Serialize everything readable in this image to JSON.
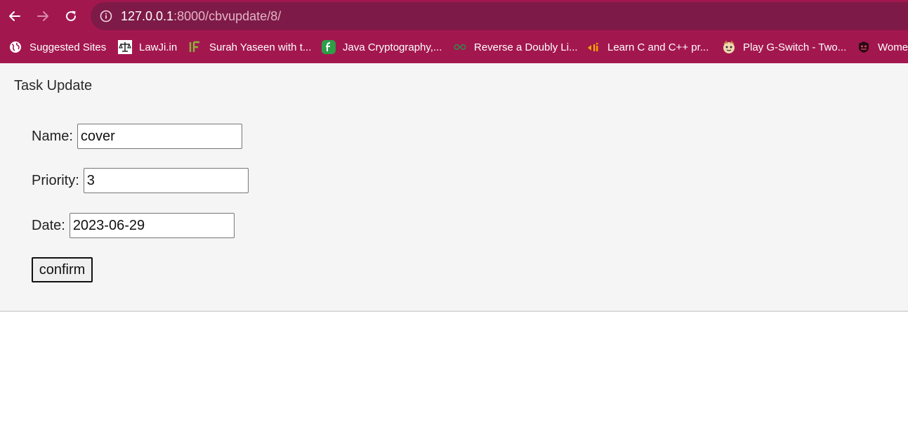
{
  "browser": {
    "url_host": "127.0.0.1",
    "url_path": ":8000/cbvupdate/8/",
    "theme_color": "#a3174f",
    "omnibox_color": "#7e1a47",
    "bookmarks": [
      {
        "label": "Suggested Sites",
        "icon": "globe-icon"
      },
      {
        "label": "LawJi.in",
        "icon": "scales-icon"
      },
      {
        "label": "Surah Yaseen with t...",
        "icon": "if-logo-icon"
      },
      {
        "label": "Java Cryptography,...",
        "icon": "f-leaf-icon"
      },
      {
        "label": "Reverse a Doubly Li...",
        "icon": "glasses-icon"
      },
      {
        "label": "Learn C and C++ pr...",
        "icon": "dji-logo-icon"
      },
      {
        "label": "Play G-Switch - Two...",
        "icon": "game-face-icon"
      },
      {
        "label": "Wome",
        "icon": "shield-icon"
      }
    ]
  },
  "page": {
    "title": "Task Update",
    "form": {
      "name_label": "Name:",
      "name_value": "cover",
      "priority_label": "Priority:",
      "priority_value": "3",
      "date_label": "Date:",
      "date_value": "2023-06-29",
      "submit_label": "confirm"
    }
  }
}
